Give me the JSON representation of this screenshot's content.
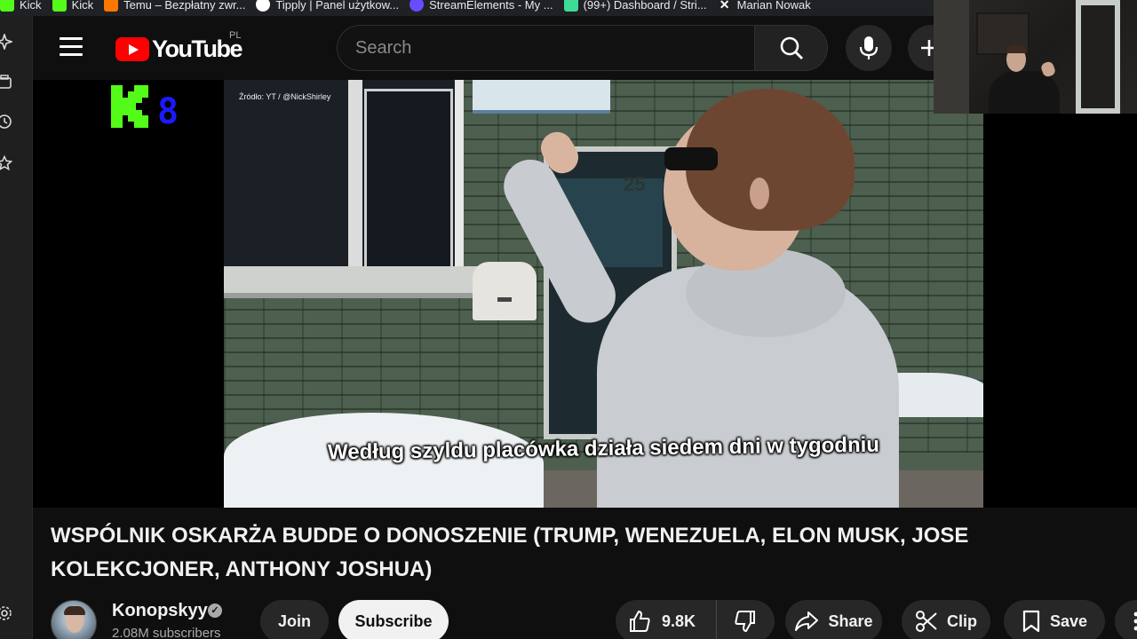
{
  "bookmarks": [
    {
      "label": "Kick",
      "icon": "kick-icon",
      "color": "#53fc18"
    },
    {
      "label": "Kick",
      "icon": "kick-icon",
      "color": "#53fc18"
    },
    {
      "label": "Temu – Bezpłatny zwr...",
      "icon": "temu-icon",
      "color": "#fb7701"
    },
    {
      "label": "Tipply | Panel użytkow...",
      "icon": "tipply-icon",
      "color": "#ffffff"
    },
    {
      "label": "StreamElements - My ...",
      "icon": "streamelements-icon",
      "color": "#6a4cff"
    },
    {
      "label": "(99+) Dashboard / Stri...",
      "icon": "dashboard-icon",
      "color": "#3ddc97"
    },
    {
      "label": "Marian Nowak",
      "icon": "x-icon",
      "color": "#ffffff"
    }
  ],
  "header": {
    "logo_text": "YouTube",
    "region": "PL",
    "search_placeholder": "Search"
  },
  "player": {
    "overlay_letter": "K",
    "overlay_number": "8",
    "source_label": "Źródło: YT / @NickShirley",
    "building_number": "25",
    "caption": "Według szyldu placówka działa siedem dni w tygodniu"
  },
  "video": {
    "title": "WSPÓLNIK OSKARŻA BUDDE O DONOSZENIE (TRUMP, WENEZUELA, ELON MUSK, JOSE KOLEKCJONER, ANTHONY JOSHUA)",
    "channel": "Konopskyy",
    "subscribers": "2.08M subscribers",
    "join_label": "Join",
    "subscribe_label": "Subscribe",
    "likes": "9.8K",
    "share_label": "Share",
    "clip_label": "Clip",
    "save_label": "Save"
  },
  "colors": {
    "background": "#0f0f0f",
    "youtube_red": "#ff0000",
    "pill": "#272727",
    "subscribe_bg": "#f1f1f1",
    "overlay_green": "#53fc18",
    "overlay_blue": "#1a1aff"
  }
}
